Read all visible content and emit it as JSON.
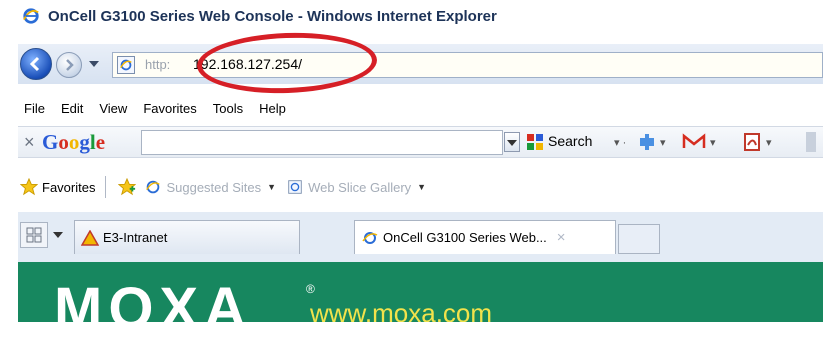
{
  "window": {
    "title": "OnCell G3100 Series Web Console - Windows Internet Explorer"
  },
  "address_bar": {
    "prefix": "http:",
    "url": "192.168.127.254/"
  },
  "menu": [
    "File",
    "Edit",
    "View",
    "Favorites",
    "Tools",
    "Help"
  ],
  "google_toolbar": {
    "logo": "Google",
    "search_value": "",
    "search_label": "Search"
  },
  "favorites_bar": {
    "favorites_label": "Favorites",
    "links": [
      "Suggested Sites",
      "Web Slice Gallery"
    ]
  },
  "tabs": {
    "items": [
      {
        "label": "E3-Intranet"
      },
      {
        "label": "OnCell G3100 Series Web..."
      }
    ]
  },
  "page": {
    "logo": "MOXA",
    "site_url": "www.moxa.com"
  },
  "colors": {
    "highlight_oval": "#d61f26",
    "content_bg": "#17875f",
    "url_text": "#f2e24b"
  }
}
